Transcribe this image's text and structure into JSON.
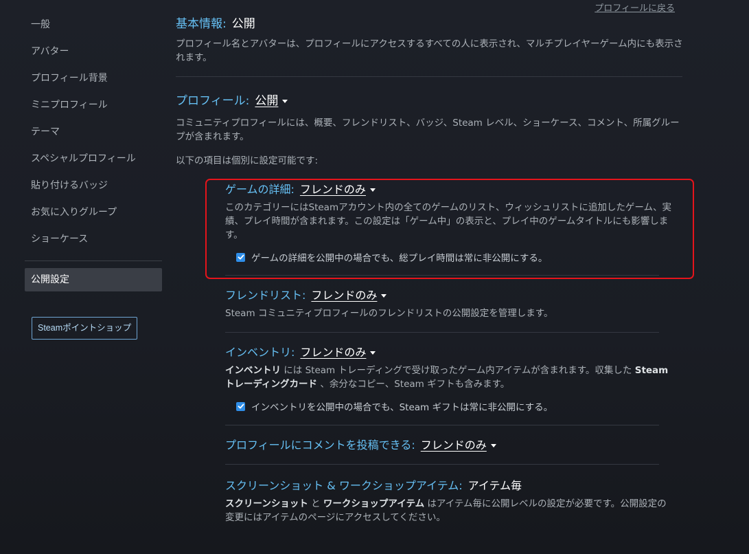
{
  "header": {
    "back_link": "プロフィールに戻る"
  },
  "sidebar": {
    "items": [
      {
        "label": "一般"
      },
      {
        "label": "アバター"
      },
      {
        "label": "プロフィール背景"
      },
      {
        "label": "ミニプロフィール"
      },
      {
        "label": "テーマ"
      },
      {
        "label": "スペシャルプロフィール"
      },
      {
        "label": "貼り付けるバッジ"
      },
      {
        "label": "お気に入りグループ"
      },
      {
        "label": "ショーケース"
      }
    ],
    "active_item": "公開設定",
    "points_button": "Steamポイントショップ"
  },
  "basic_info": {
    "label": "基本情報:",
    "value": "公開",
    "desc": "プロフィール名とアバターは、プロフィールにアクセスするすべての人に表示され、マルチプレイヤーゲーム内にも表示されます。"
  },
  "profile": {
    "label": "プロフィール:",
    "value": "公開",
    "desc": "コミュニティプロフィールには、概要、フレンドリスト、バッジ、Steam レベル、ショーケース、コメント、所属グループが含まれます。",
    "note": "以下の項目は個別に設定可能です:"
  },
  "game_details": {
    "label": "ゲームの詳細:",
    "value": "フレンドのみ",
    "desc": "このカテゴリーにはSteamアカウント内の全てのゲームのリスト、ウィッシュリストに追加したゲーム、実績、プレイ時間が含まれます。この設定は「ゲーム中」の表示と、プレイ中のゲームタイトルにも影響します。",
    "checkbox_label": "ゲームの詳細を公開中の場合でも、総プレイ時間は常に非公開にする。",
    "checked": true
  },
  "friends_list": {
    "label": "フレンドリスト:",
    "value": "フレンドのみ",
    "desc": "Steam コミュニティプロフィールのフレンドリストの公開設定を管理します。"
  },
  "inventory": {
    "label": "インベントリ:",
    "value": "フレンドのみ",
    "desc_b1": "インベントリ",
    "desc_t1": " には Steam トレーディングで受け取ったゲーム内アイテムが含まれます。収集した ",
    "desc_b2": "Steam トレーディングカード",
    "desc_t2": " 、余分なコピー、Steam ギフトも含みます。",
    "checkbox_label": "インベントリを公開中の場合でも、Steam ギフトは常に非公開にする。",
    "checked": true
  },
  "comments": {
    "label": "プロフィールにコメントを投稿できる:",
    "value": "フレンドのみ"
  },
  "screenshots": {
    "label": "スクリーンショット & ワークショップアイテム:",
    "value": "アイテム毎",
    "desc_b1": "スクリーンショット",
    "desc_t1": " と ",
    "desc_b2": "ワークショップアイテム",
    "desc_t2": " はアイテム毎に公開レベルの設定が必要です。公開設定の変更にはアイテムのページにアクセスしてください。"
  },
  "colors": {
    "accent": "#66c0f4",
    "checkbox": "#2f8ee8",
    "highlight_border": "#e5141b"
  }
}
